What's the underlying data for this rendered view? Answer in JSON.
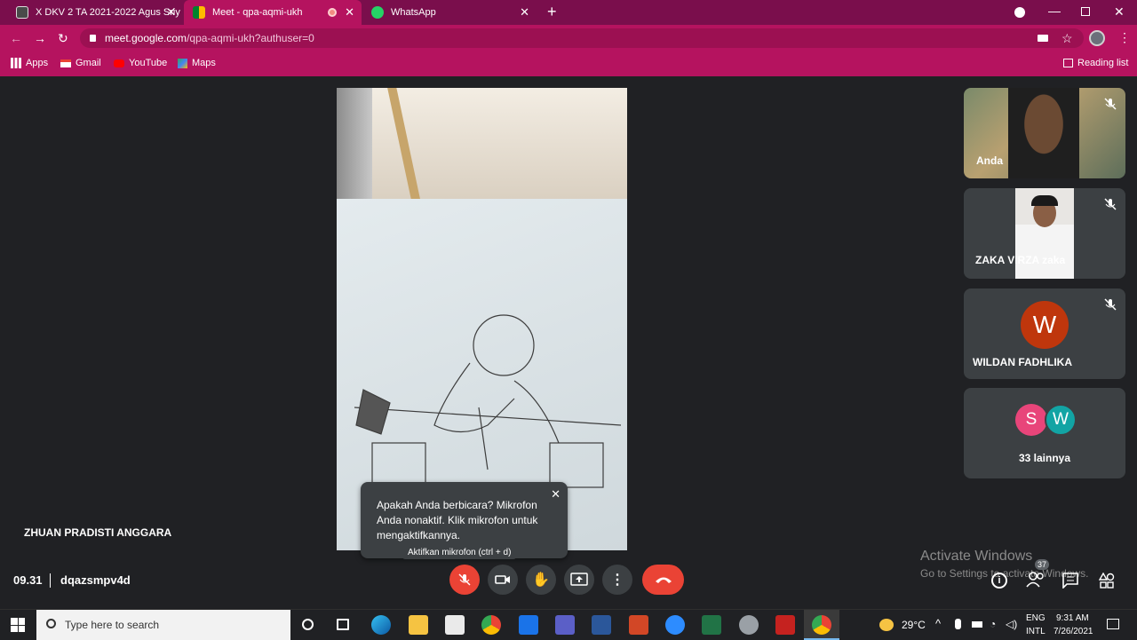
{
  "browser": {
    "tabs": [
      {
        "label": "X DKV 2 TA 2021-2022 Agus Sriy",
        "active": false
      },
      {
        "label": "Meet - qpa-aqmi-ukh",
        "active": true
      },
      {
        "label": "WhatsApp",
        "active": false
      }
    ],
    "url_domain": "meet.google.com",
    "url_path": "/qpa-aqmi-ukh?authuser=0",
    "bookmarks": [
      "Apps",
      "Gmail",
      "YouTube",
      "Maps"
    ],
    "reading_list": "Reading list",
    "colors": {
      "tabbar": "#7a0e4c",
      "toolbar": "#b5135f"
    }
  },
  "meet": {
    "presenter_name": "ZHUAN PRADISTI ANGGARA",
    "time": "09.31",
    "meeting_code": "dqazsmpv4d",
    "tooltip_text": "Apakah Anda berbicara? Mikrofon Anda nonaktif. Klik mikrofon untuk mengaktifkannya.",
    "mic_hint": "Aktifkan mikrofon (ctrl + d)",
    "participants": [
      {
        "name": "Anda"
      },
      {
        "name": "ZAKA VIRZA zaka"
      },
      {
        "name": "WILDAN FADHLIKA",
        "initial": "W",
        "color": "#bf360c"
      }
    ],
    "others": {
      "label": "33 lainnya",
      "initials": [
        "S",
        "W"
      ],
      "colors": [
        "#e8457a",
        "#12a4a4"
      ]
    },
    "people_count": "37",
    "watermark_title": "Activate Windows",
    "watermark_sub": "Go to Settings to activate Windows.",
    "colors": {
      "end_call": "#ea4335",
      "mic_off": "#ea4335"
    }
  },
  "taskbar": {
    "search_placeholder": "Type here to search",
    "weather": "29°C",
    "lang_top": "ENG",
    "lang_bottom": "INTL",
    "clock_time": "9:31 AM",
    "clock_date": "7/26/2021"
  }
}
